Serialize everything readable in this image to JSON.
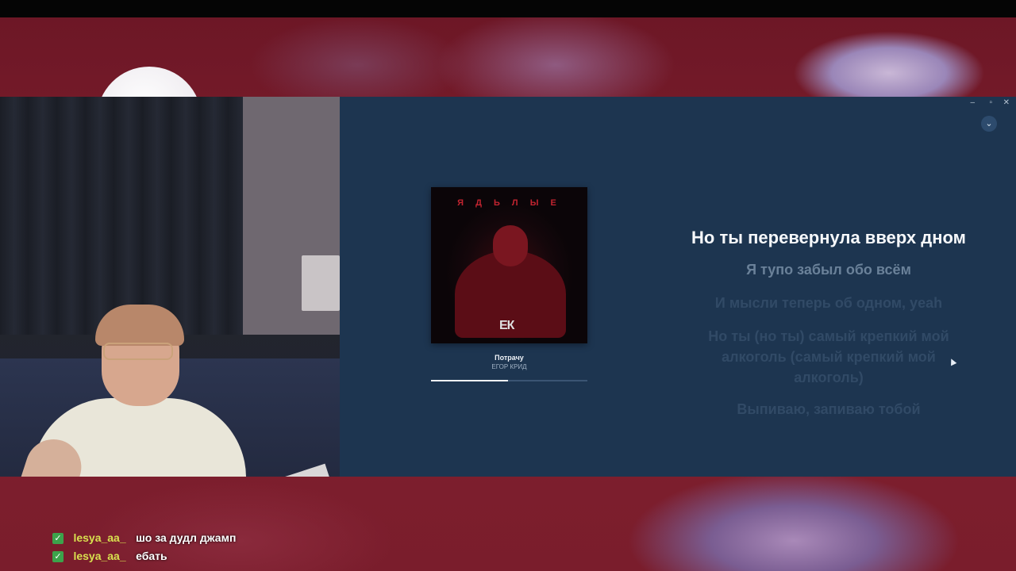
{
  "player": {
    "window_controls": {
      "minimize": "–",
      "maximize": "▫",
      "close": "✕"
    },
    "collapse_icon": "⌄",
    "album": {
      "cover_title": "Я Д Ь Л Ы Е",
      "logo_text": "ЕК"
    },
    "track": {
      "title": "Потрачу",
      "artist": "ЕГОР КРИД",
      "progress": 0.49
    },
    "lyrics": [
      "Но ты перевернула вверх дном",
      "Я тупо забыл обо всём",
      "И мысли теперь об одном, yeah",
      "Но ты (но ты) самый крепкий мой алкоголь (самый крепкий мой алкоголь)",
      "Выпиваю, запиваю тобой"
    ],
    "colors": {
      "background": "#1d3550",
      "active_lyric": "#f6f8fb",
      "accent_red": "#c22430"
    }
  },
  "chat": {
    "messages": [
      {
        "user": "lesya_aa_",
        "text": "шо за дудл джамп",
        "badge": "✓"
      },
      {
        "user": "lesya_aa_",
        "text": "ебать",
        "badge": "✓"
      }
    ]
  }
}
